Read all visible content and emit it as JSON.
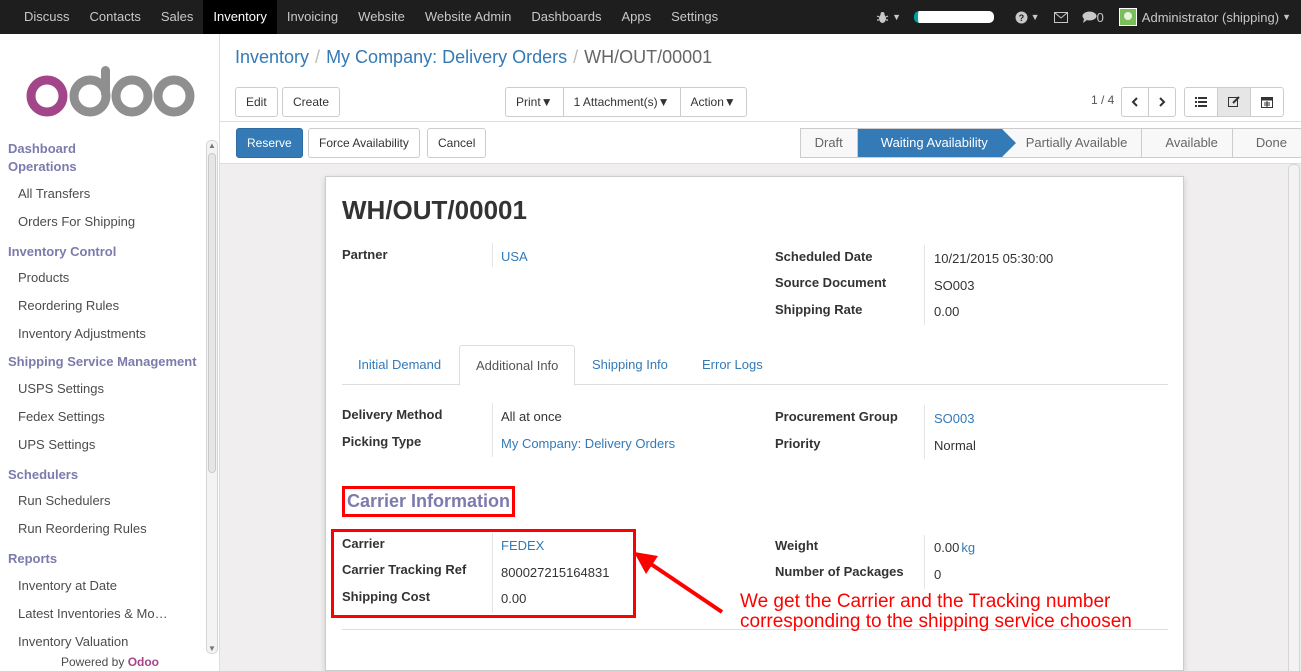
{
  "topnav": {
    "items": [
      "Discuss",
      "Contacts",
      "Sales",
      "Inventory",
      "Invoicing",
      "Website",
      "Website Admin",
      "Dashboards",
      "Apps",
      "Settings"
    ],
    "active": "Inventory",
    "chat_count": "0",
    "user": "Administrator (shipping)"
  },
  "sidebar": {
    "sections": [
      {
        "title": "Dashboard",
        "items": []
      },
      {
        "title": "Operations",
        "items": [
          "All Transfers",
          "Orders For Shipping"
        ]
      },
      {
        "title": "Inventory Control",
        "items": [
          "Products",
          "Reordering Rules",
          "Inventory Adjustments"
        ]
      },
      {
        "title": "Shipping Service Management",
        "items": [
          "USPS Settings",
          "Fedex Settings",
          "UPS Settings"
        ]
      },
      {
        "title": "Schedulers",
        "items": [
          "Run Schedulers",
          "Run Reordering Rules"
        ]
      },
      {
        "title": "Reports",
        "items": [
          "Inventory at Date",
          "Latest Inventories & Mo…",
          "Inventory Valuation"
        ]
      }
    ],
    "powered_by": "Powered by",
    "powered_brand": "Odoo"
  },
  "breadcrumb": {
    "root": "Inventory",
    "parent": "My Company: Delivery Orders",
    "current": "WH/OUT/00001"
  },
  "buttons": {
    "edit": "Edit",
    "create": "Create",
    "print": "Print",
    "attachments": "1 Attachment(s)",
    "action": "Action",
    "reserve": "Reserve",
    "force": "Force Availability",
    "cancel": "Cancel"
  },
  "pager": "1 / 4",
  "statusbar": {
    "steps": [
      "Draft",
      "Waiting Availability",
      "Partially Available",
      "Available",
      "Done"
    ],
    "current": "Waiting Availability"
  },
  "form": {
    "title": "WH/OUT/00001",
    "partner_label": "Partner",
    "partner": "USA",
    "scheduled_label": "Scheduled Date",
    "scheduled": "10/21/2015 05:30:00",
    "source_label": "Source Document",
    "source": "SO003",
    "rate_label": "Shipping Rate",
    "rate": "0.00",
    "tabs": [
      "Initial Demand",
      "Additional Info",
      "Shipping Info",
      "Error Logs"
    ],
    "active_tab": "Additional Info",
    "delivery_label": "Delivery Method",
    "delivery": "All at once",
    "picking_label": "Picking Type",
    "picking": "My Company: Delivery Orders",
    "group_label": "Procurement Group",
    "group": "SO003",
    "priority_label": "Priority",
    "priority": "Normal",
    "carrier_section": "Carrier Information",
    "carrier_label": "Carrier",
    "carrier": "FEDEX",
    "tracking_label": "Carrier Tracking Ref",
    "tracking": "800027215164831",
    "cost_label": "Shipping Cost",
    "cost": "0.00",
    "weight_label": "Weight",
    "weight": "0.00",
    "weight_unit": "kg",
    "packages_label": "Number of Packages",
    "packages": "0"
  },
  "annotation": {
    "line1": "We get the Carrier and the Tracking number",
    "line2": "corresponding to the shipping service choosen",
    "color": "#ff0000"
  }
}
